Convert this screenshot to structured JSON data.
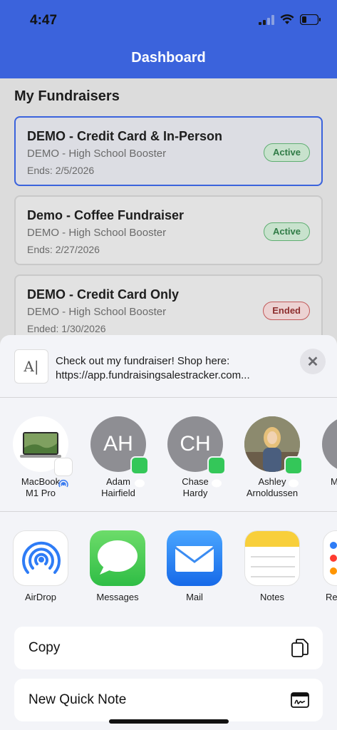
{
  "status_bar": {
    "time": "4:47"
  },
  "header": {
    "title": "Dashboard"
  },
  "dashboard": {
    "section_title": "My Fundraisers",
    "fundraisers": [
      {
        "name": "DEMO - Credit Card & In-Person",
        "org": "DEMO - High School Booster",
        "end": "Ends: 2/5/2026",
        "status": "Active"
      },
      {
        "name": "Demo - Coffee Fundraiser",
        "org": "DEMO - High School Booster",
        "end": "Ends: 2/27/2026",
        "status": "Active"
      },
      {
        "name": "DEMO - Credit Card Only",
        "org": "DEMO - High School Booster",
        "end": "Ended: 1/30/2026",
        "status": "Ended"
      }
    ]
  },
  "share_sheet": {
    "message_line1": "Check out my fundraiser! Shop here:",
    "message_line2": "https://app.fundraisingsalestracker.com...",
    "people": [
      {
        "line1": "MacBook",
        "line2": "M1 Pro",
        "initials": ""
      },
      {
        "line1": "Adam",
        "line2": "Hairfield",
        "initials": "AH"
      },
      {
        "line1": "Chase",
        "line2": "Hardy",
        "initials": "CH"
      },
      {
        "line1": "Ashley",
        "line2": "Arnoldussen",
        "initials": ""
      },
      {
        "line1": "M",
        "line2": "",
        "initials": ""
      }
    ],
    "apps": [
      {
        "label": "AirDrop",
        "icon": "airdrop-icon"
      },
      {
        "label": "Messages",
        "icon": "messages-icon"
      },
      {
        "label": "Mail",
        "icon": "mail-icon"
      },
      {
        "label": "Notes",
        "icon": "notes-icon"
      },
      {
        "label": "Re",
        "icon": "reminders-icon"
      }
    ],
    "actions": [
      {
        "label": "Copy",
        "icon": "copy-icon"
      },
      {
        "label": "New Quick Note",
        "icon": "quick-note-icon"
      }
    ]
  },
  "colors": {
    "header_blue": "#3b63dc",
    "active_green": "#2f7b45",
    "ended_red": "#8d2e2e"
  }
}
